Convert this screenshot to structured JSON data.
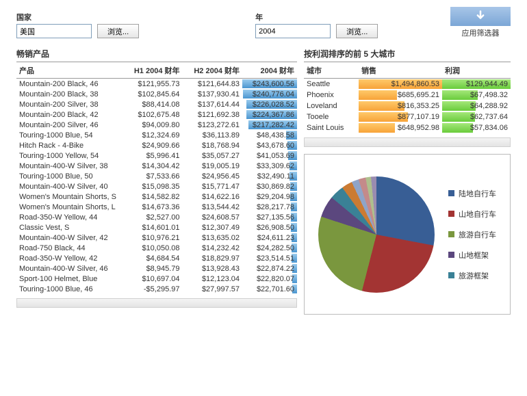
{
  "filters": {
    "country_label": "国家",
    "country_value": "美国",
    "year_label": "年",
    "year_value": "2004",
    "browse": "浏览...",
    "apply": "应用筛选器"
  },
  "products": {
    "title": "畅销产品",
    "cols": {
      "product": "产品",
      "h1": "H1 2004 财年",
      "h2": "H2 2004 财年",
      "fy": "2004 财年"
    },
    "rows": [
      {
        "name": "Mountain-200 Black, 46",
        "h1": "$121,955.73",
        "h2": "$121,644.83",
        "fy": "$243,600.56"
      },
      {
        "name": "Mountain-200 Black, 38",
        "h1": "$102,845.64",
        "h2": "$137,930.41",
        "fy": "$240,776.04"
      },
      {
        "name": "Mountain-200 Silver, 38",
        "h1": "$88,414.08",
        "h2": "$137,614.44",
        "fy": "$226,028.52"
      },
      {
        "name": "Mountain-200 Black, 42",
        "h1": "$102,675.48",
        "h2": "$121,692.38",
        "fy": "$224,367.86"
      },
      {
        "name": "Mountain-200 Silver, 46",
        "h1": "$94,009.80",
        "h2": "$123,272.61",
        "fy": "$217,282.42"
      },
      {
        "name": "Touring-1000 Blue, 54",
        "h1": "$12,324.69",
        "h2": "$36,113.89",
        "fy": "$48,438.58"
      },
      {
        "name": "Hitch Rack - 4-Bike",
        "h1": "$24,909.66",
        "h2": "$18,768.94",
        "fy": "$43,678.60"
      },
      {
        "name": "Touring-1000 Yellow, 54",
        "h1": "$5,996.41",
        "h2": "$35,057.27",
        "fy": "$41,053.69"
      },
      {
        "name": "Mountain-400-W Silver, 38",
        "h1": "$14,304.42",
        "h2": "$19,005.19",
        "fy": "$33,309.62"
      },
      {
        "name": "Touring-1000 Blue, 50",
        "h1": "$7,533.66",
        "h2": "$24,956.45",
        "fy": "$32,490.11"
      },
      {
        "name": "Mountain-400-W Silver, 40",
        "h1": "$15,098.35",
        "h2": "$15,771.47",
        "fy": "$30,869.82"
      },
      {
        "name": "Women's Mountain Shorts, S",
        "h1": "$14,582.82",
        "h2": "$14,622.16",
        "fy": "$29,204.98"
      },
      {
        "name": "Women's Mountain Shorts, L",
        "h1": "$14,673.36",
        "h2": "$13,544.42",
        "fy": "$28,217.78"
      },
      {
        "name": "Road-350-W Yellow, 44",
        "h1": "$2,527.00",
        "h2": "$24,608.57",
        "fy": "$27,135.56"
      },
      {
        "name": "Classic Vest, S",
        "h1": "$14,601.01",
        "h2": "$12,307.49",
        "fy": "$26,908.50"
      },
      {
        "name": "Mountain-400-W Silver, 42",
        "h1": "$10,976.21",
        "h2": "$13,635.02",
        "fy": "$24,611.23"
      },
      {
        "name": "Road-750 Black, 44",
        "h1": "$10,050.08",
        "h2": "$14,232.42",
        "fy": "$24,282.50"
      },
      {
        "name": "Road-350-W Yellow, 42",
        "h1": "$4,684.54",
        "h2": "$18,829.97",
        "fy": "$23,514.51"
      },
      {
        "name": "Mountain-400-W Silver, 46",
        "h1": "$8,945.79",
        "h2": "$13,928.43",
        "fy": "$22,874.22"
      },
      {
        "name": "Sport-100 Helmet, Blue",
        "h1": "$10,697.04",
        "h2": "$12,123.04",
        "fy": "$22,820.07"
      },
      {
        "name": "Touring-1000 Blue, 46",
        "h1": "-$5,295.97",
        "h2": "$27,997.57",
        "fy": "$22,701.60"
      }
    ]
  },
  "cities": {
    "title": "按利润排序的前 5 大城市",
    "cols": {
      "city": "城市",
      "sales": "销售",
      "profit": "利润"
    },
    "rows": [
      {
        "city": "Seattle",
        "sales": "$1,494,860.53",
        "profit": "$129,944.49"
      },
      {
        "city": "Phoenix",
        "sales": "$685,695.21",
        "profit": "$67,498.32"
      },
      {
        "city": "Loveland",
        "sales": "$816,353.25",
        "profit": "$64,288.92"
      },
      {
        "city": "Tooele",
        "sales": "$877,107.19",
        "profit": "$62,737.64"
      },
      {
        "city": "Saint Louis",
        "sales": "$648,952.98",
        "profit": "$57,834.06"
      }
    ]
  },
  "chart_data": {
    "type": "pie",
    "title": "",
    "series": [
      {
        "name": "陆地自行车",
        "value": 28,
        "color": "#385e95"
      },
      {
        "name": "山地自行车",
        "value": 26,
        "color": "#a33433"
      },
      {
        "name": "旅游自行车",
        "value": 26,
        "color": "#7a973e"
      },
      {
        "name": "山地框架",
        "value": 6,
        "color": "#5b477e"
      },
      {
        "name": "旅游框架",
        "value": 4,
        "color": "#3a8196"
      },
      {
        "name": "_other1",
        "value": 3,
        "color": "#cb7b33"
      },
      {
        "name": "_other2",
        "value": 2,
        "color": "#8fa4c8"
      },
      {
        "name": "_other3",
        "value": 2,
        "color": "#c48a8a"
      },
      {
        "name": "_other4",
        "value": 1.5,
        "color": "#aebf8d"
      },
      {
        "name": "_other5",
        "value": 1.5,
        "color": "#9a8cb0"
      }
    ],
    "legend": [
      {
        "name": "陆地自行车",
        "color": "#385e95"
      },
      {
        "name": "山地自行车",
        "color": "#a33433"
      },
      {
        "name": "旅游自行车",
        "color": "#7a973e"
      },
      {
        "name": "山地框架",
        "color": "#5b477e"
      },
      {
        "name": "旅游框架",
        "color": "#3a8196"
      }
    ]
  }
}
